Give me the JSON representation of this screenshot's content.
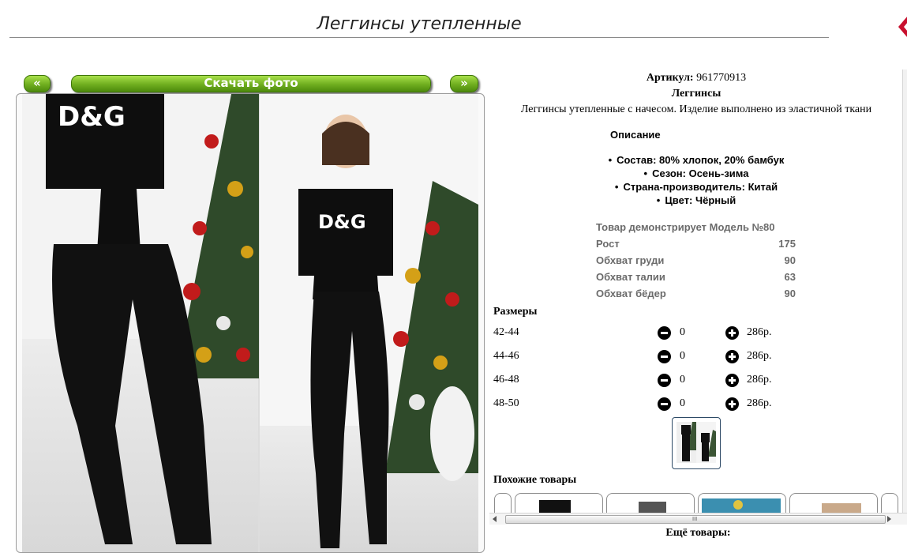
{
  "page": {
    "title": "Леггинсы утепленные"
  },
  "gallery": {
    "prev_label": "«",
    "download_label": "Скачать фото",
    "next_label": "»"
  },
  "product": {
    "article_label": "Артикул:",
    "article_value": "961770913",
    "name": "Леггинсы",
    "short_description": "Леггинсы утепленные с начесом. Изделие выполнено из эластичной ткани",
    "description_heading": "Описание",
    "features": [
      "Состав: 80% хлопок, 20% бамбук",
      "Сезон: Осень-зима",
      "Страна-производитель: Китай",
      "Цвет: Чёрный"
    ],
    "measurements": [
      {
        "label": "Товар демонстрирует Модель №80",
        "value": ""
      },
      {
        "label": "Рост",
        "value": "175"
      },
      {
        "label": "Обхват груди",
        "value": "90"
      },
      {
        "label": "Обхват талии",
        "value": "63"
      },
      {
        "label": "Обхват бёдер",
        "value": "90"
      }
    ]
  },
  "sizes": {
    "heading": "Размеры",
    "rows": [
      {
        "label": "42-44",
        "qty": "0",
        "price": "286р."
      },
      {
        "label": "44-46",
        "qty": "0",
        "price": "286р."
      },
      {
        "label": "46-48",
        "qty": "0",
        "price": "286р."
      },
      {
        "label": "48-50",
        "qty": "0",
        "price": "286р."
      }
    ]
  },
  "similar": {
    "heading": "Похожие товары"
  },
  "scrollbar": {
    "grip": "III"
  },
  "footer": {
    "more_goods": "Ещё товары:"
  },
  "colors": {
    "accent_green": "#6fae1f",
    "close_red": "#c8102e"
  },
  "icons": {
    "minus": "minus-circle-icon",
    "plus": "plus-circle-icon"
  }
}
